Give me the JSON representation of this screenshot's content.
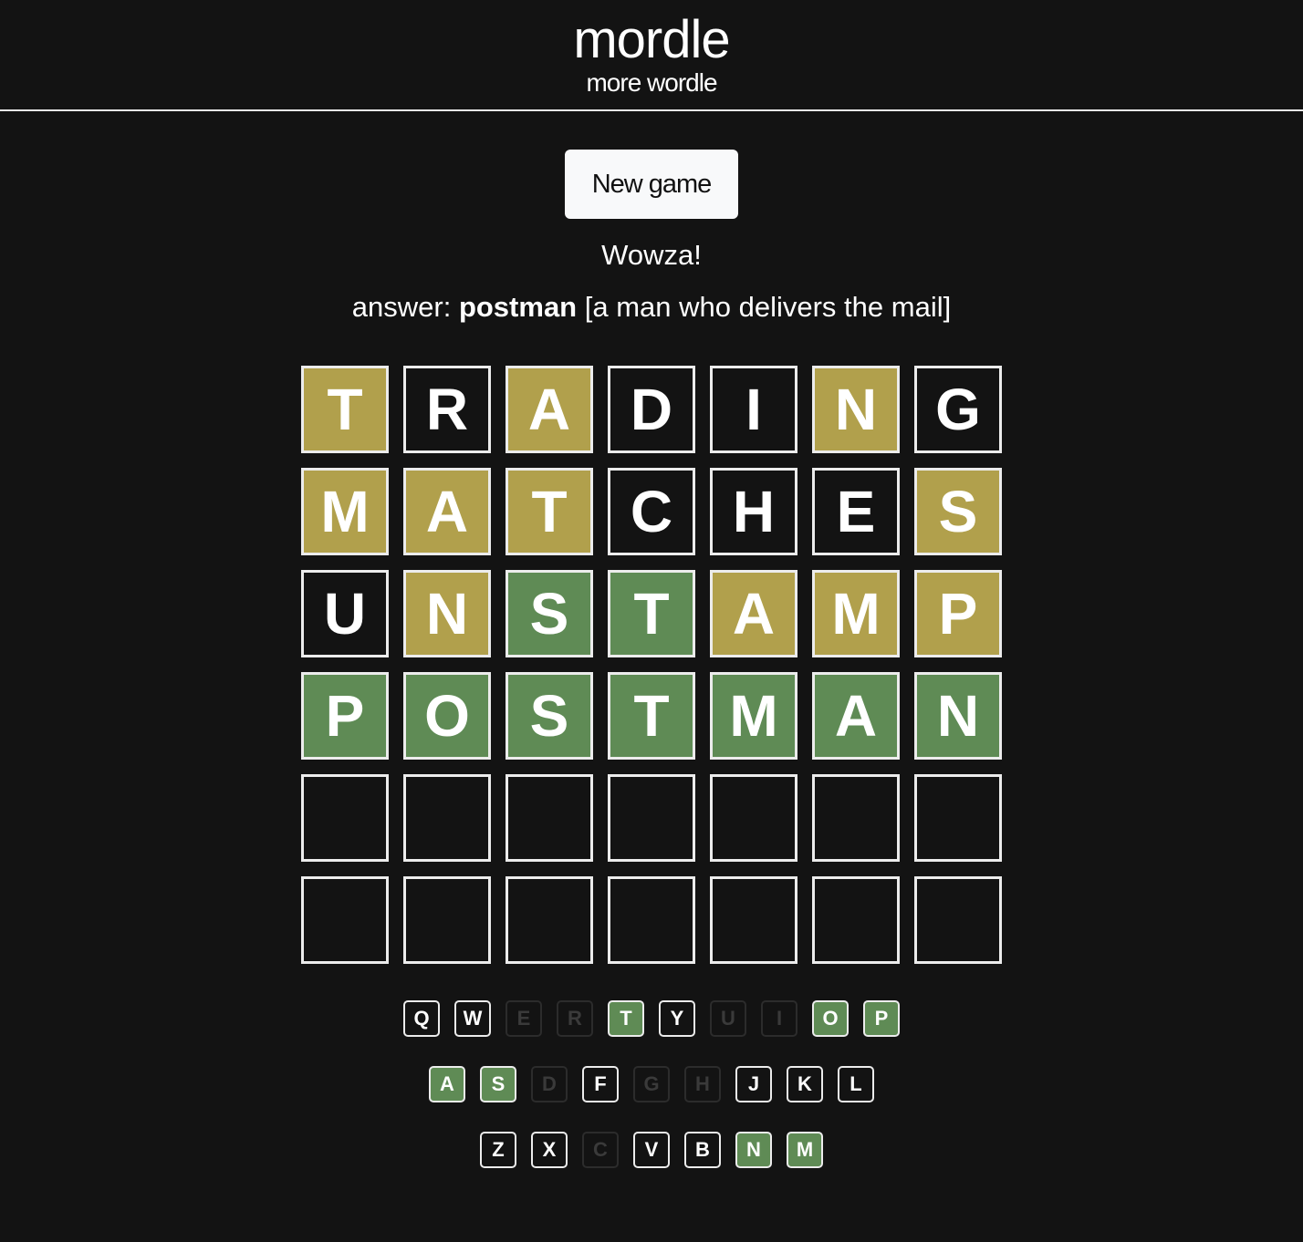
{
  "header": {
    "title": "mordle",
    "subtitle": "more wordle"
  },
  "controls": {
    "new_game_label": "New game"
  },
  "status": {
    "message": "Wowza!",
    "answer_prefix": "answer:",
    "answer_word": "postman",
    "answer_definition": "[a man who delivers the mail]"
  },
  "board": {
    "rows": [
      [
        {
          "letter": "T",
          "state": "present"
        },
        {
          "letter": "R",
          "state": "absent"
        },
        {
          "letter": "A",
          "state": "present"
        },
        {
          "letter": "D",
          "state": "absent"
        },
        {
          "letter": "I",
          "state": "absent"
        },
        {
          "letter": "N",
          "state": "present"
        },
        {
          "letter": "G",
          "state": "absent"
        }
      ],
      [
        {
          "letter": "M",
          "state": "present"
        },
        {
          "letter": "A",
          "state": "present"
        },
        {
          "letter": "T",
          "state": "present"
        },
        {
          "letter": "C",
          "state": "absent"
        },
        {
          "letter": "H",
          "state": "absent"
        },
        {
          "letter": "E",
          "state": "absent"
        },
        {
          "letter": "S",
          "state": "present"
        }
      ],
      [
        {
          "letter": "U",
          "state": "absent"
        },
        {
          "letter": "N",
          "state": "present"
        },
        {
          "letter": "S",
          "state": "correct"
        },
        {
          "letter": "T",
          "state": "correct"
        },
        {
          "letter": "A",
          "state": "present"
        },
        {
          "letter": "M",
          "state": "present"
        },
        {
          "letter": "P",
          "state": "present"
        }
      ],
      [
        {
          "letter": "P",
          "state": "correct"
        },
        {
          "letter": "O",
          "state": "correct"
        },
        {
          "letter": "S",
          "state": "correct"
        },
        {
          "letter": "T",
          "state": "correct"
        },
        {
          "letter": "M",
          "state": "correct"
        },
        {
          "letter": "A",
          "state": "correct"
        },
        {
          "letter": "N",
          "state": "correct"
        }
      ],
      [
        {
          "letter": "",
          "state": "empty"
        },
        {
          "letter": "",
          "state": "empty"
        },
        {
          "letter": "",
          "state": "empty"
        },
        {
          "letter": "",
          "state": "empty"
        },
        {
          "letter": "",
          "state": "empty"
        },
        {
          "letter": "",
          "state": "empty"
        },
        {
          "letter": "",
          "state": "empty"
        }
      ],
      [
        {
          "letter": "",
          "state": "empty"
        },
        {
          "letter": "",
          "state": "empty"
        },
        {
          "letter": "",
          "state": "empty"
        },
        {
          "letter": "",
          "state": "empty"
        },
        {
          "letter": "",
          "state": "empty"
        },
        {
          "letter": "",
          "state": "empty"
        },
        {
          "letter": "",
          "state": "empty"
        }
      ]
    ]
  },
  "keyboard": {
    "rows": [
      [
        {
          "key": "Q",
          "state": "unused"
        },
        {
          "key": "W",
          "state": "unused"
        },
        {
          "key": "E",
          "state": "absent"
        },
        {
          "key": "R",
          "state": "absent"
        },
        {
          "key": "T",
          "state": "correct"
        },
        {
          "key": "Y",
          "state": "unused"
        },
        {
          "key": "U",
          "state": "absent"
        },
        {
          "key": "I",
          "state": "absent"
        },
        {
          "key": "O",
          "state": "correct"
        },
        {
          "key": "P",
          "state": "correct"
        }
      ],
      [
        {
          "key": "A",
          "state": "correct"
        },
        {
          "key": "S",
          "state": "correct"
        },
        {
          "key": "D",
          "state": "absent"
        },
        {
          "key": "F",
          "state": "unused"
        },
        {
          "key": "G",
          "state": "absent"
        },
        {
          "key": "H",
          "state": "absent"
        },
        {
          "key": "J",
          "state": "unused"
        },
        {
          "key": "K",
          "state": "unused"
        },
        {
          "key": "L",
          "state": "unused"
        }
      ],
      [
        {
          "key": "Z",
          "state": "unused"
        },
        {
          "key": "X",
          "state": "unused"
        },
        {
          "key": "C",
          "state": "absent"
        },
        {
          "key": "V",
          "state": "unused"
        },
        {
          "key": "B",
          "state": "unused"
        },
        {
          "key": "N",
          "state": "correct"
        },
        {
          "key": "M",
          "state": "correct"
        }
      ]
    ]
  },
  "colors": {
    "background": "#131313",
    "present": "#b1a04c",
    "correct": "#5f8b55",
    "tile_border": "#ececec",
    "absent_key": "#3a3a3a"
  }
}
